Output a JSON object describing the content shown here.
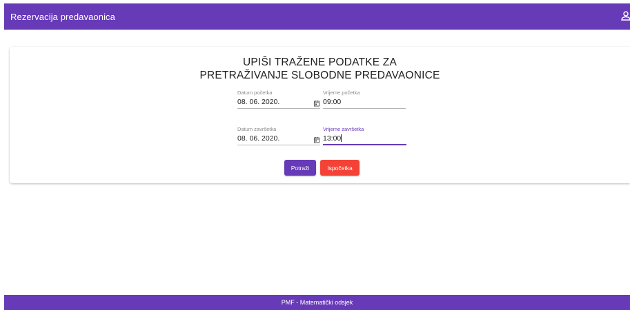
{
  "toolbar": {
    "title": "Rezervacija predavaonica",
    "account_icon": "account-icon"
  },
  "form": {
    "heading_line1": "UPIŠI TRAŽENE PODATKE ZA",
    "heading_line2": "PRETRAŽIVANJE SLOBODNE PREDAVAONICE",
    "start_date": {
      "label": "Datum početka",
      "value": "08. 06. 2020."
    },
    "start_time": {
      "label": "Vrijeme početka",
      "value": "09:00"
    },
    "end_date": {
      "label": "Datum završetka",
      "value": "08. 06. 2020."
    },
    "end_time": {
      "label": "Vrijeme završetka",
      "value": "13:00"
    },
    "search_label": "Potraži",
    "reset_label": "Ispočetka"
  },
  "footer": {
    "text": "PMF - Matematički odsjek"
  },
  "colors": {
    "primary": "#673ab7",
    "warn": "#f44336"
  }
}
